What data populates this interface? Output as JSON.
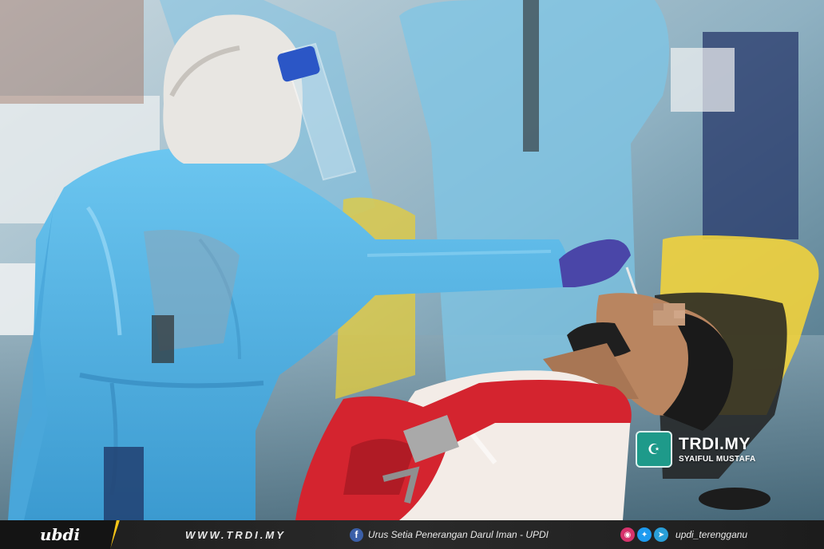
{
  "photo": {
    "subject": "health worker in protective gear collecting nasal swab"
  },
  "credit": {
    "logo_glyph": "☪",
    "site": "TRDI.MY",
    "photographer": "SYAIFUL MUSTAFA"
  },
  "footer": {
    "brand": "ubdi",
    "website": "WWW.TRDI.MY",
    "facebook_label": "Urus Setia Penerangan Darul Iman - UPDI",
    "social_handle": "updi_terengganu",
    "icons": [
      "facebook-icon",
      "instagram-icon",
      "twitter-icon",
      "telegram-icon"
    ]
  },
  "colors": {
    "gown": "#5bb8e6",
    "background": "#2b4a5e",
    "footer": "#1f1f1f",
    "accent": "#f5c518",
    "bag": "#d4242f"
  }
}
